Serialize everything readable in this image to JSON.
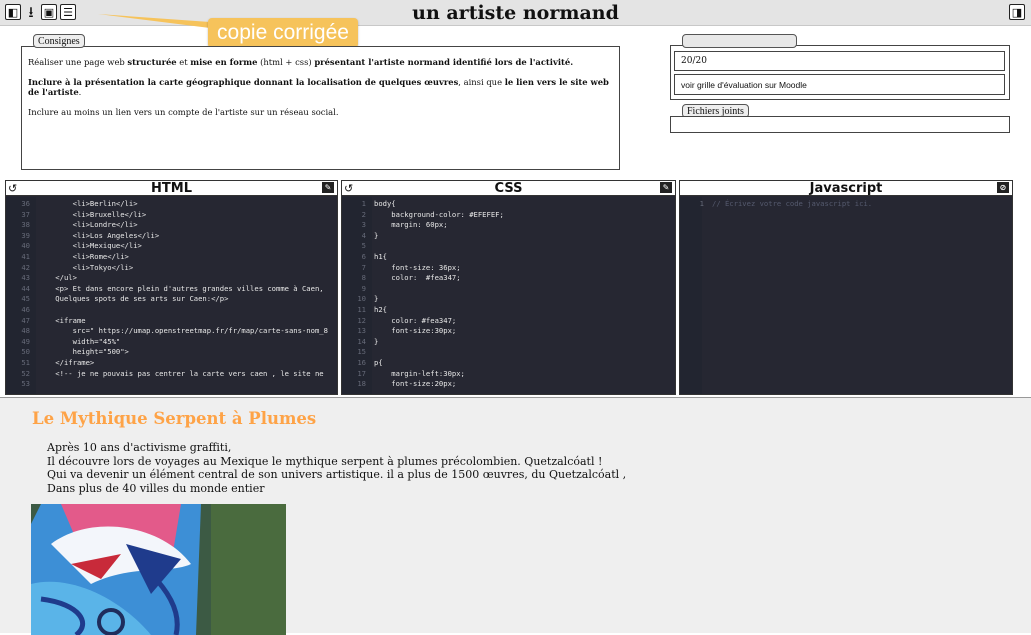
{
  "header": {
    "title": "un artiste normand",
    "tooltip": "copie corrigée",
    "tool_icons": [
      "collapse-left-icon",
      "download-icon",
      "save-icon",
      "list-icon"
    ],
    "right_icon": "collapse-right-icon"
  },
  "consignes": {
    "tab_label": "Consignes",
    "p1_pre": "Réaliser une page web ",
    "p1_b1": "structurée",
    "p1_mid1": "  et ",
    "p1_b2": "mise en forme",
    "p1_mid2": " (html + css) ",
    "p1_b3": "présentant l'artiste normand identifié lors de l'activité.",
    "p2_b1": "Inclure à la présentation la carte géographique donnant la localisation de quelques œuvres",
    "p2_mid": ", ainsi que ",
    "p2_b2": "le lien vers le site web de l'artiste",
    "p2_end": ".",
    "p3": "Inclure au moins un lien vers un compte de l'artiste sur un réseau social."
  },
  "evaluation": {
    "student_tab": "",
    "grade": "20/20",
    "note": "voir grille d'évaluation sur Moodle",
    "files_tab": "Fichiers joints"
  },
  "editors": {
    "html_title": "HTML",
    "css_title": "CSS",
    "js_title": "Javascript",
    "html_lines": [
      {
        "n": "36",
        "t": "        <li>Berlin</li>"
      },
      {
        "n": "37",
        "t": "        <li>Bruxelle</li>"
      },
      {
        "n": "38",
        "t": "        <li>Londre</li>"
      },
      {
        "n": "39",
        "t": "        <li>Los Angeles</li>"
      },
      {
        "n": "40",
        "t": "        <li>Mexique</li>"
      },
      {
        "n": "41",
        "t": "        <li>Rome</li>"
      },
      {
        "n": "42",
        "t": "        <li>Tokyo</li>"
      },
      {
        "n": "43",
        "t": "    </ul>"
      },
      {
        "n": "44",
        "t": "    <p> Et dans encore plein d'autres grandes villes comme à Caen,"
      },
      {
        "n": "45",
        "t": "    Quelques spots de ses arts sur Caen:</p>"
      },
      {
        "n": "46",
        "t": ""
      },
      {
        "n": "47",
        "t": "    <iframe"
      },
      {
        "n": "48",
        "t": "        src=\" https://umap.openstreetmap.fr/fr/map/carte-sans-nom_8"
      },
      {
        "n": "49",
        "t": "        width=\"45%\""
      },
      {
        "n": "50",
        "t": "        height=\"500\">"
      },
      {
        "n": "51",
        "t": "    </iframe>"
      },
      {
        "n": "52",
        "t": "    <!-- je ne pouvais pas centrer la carte vers caen , le site ne"
      },
      {
        "n": "53",
        "t": ""
      }
    ],
    "css_lines": [
      {
        "n": "1",
        "t": "body{"
      },
      {
        "n": "2",
        "t": "    background-color: #EFEFEF;"
      },
      {
        "n": "3",
        "t": "    margin: 60px;"
      },
      {
        "n": "4",
        "t": "}"
      },
      {
        "n": "5",
        "t": ""
      },
      {
        "n": "6",
        "t": "h1{"
      },
      {
        "n": "7",
        "t": "    font-size: 36px;"
      },
      {
        "n": "8",
        "t": "    color:  #fea347;"
      },
      {
        "n": "9",
        "t": ""
      },
      {
        "n": "10",
        "t": "}"
      },
      {
        "n": "11",
        "t": "h2{"
      },
      {
        "n": "12",
        "t": "    color: #fea347;"
      },
      {
        "n": "13",
        "t": "    font-size:30px;"
      },
      {
        "n": "14",
        "t": "}"
      },
      {
        "n": "15",
        "t": ""
      },
      {
        "n": "16",
        "t": "p{"
      },
      {
        "n": "17",
        "t": "    margin-left:30px;"
      },
      {
        "n": "18",
        "t": "    font-size:20px;"
      }
    ],
    "js_lines": [
      {
        "n": "1",
        "t": "// Écrivez votre code javascript ici."
      }
    ]
  },
  "preview": {
    "heading": "Le Mythique Serpent à Plumes",
    "lines": [
      "Après 10 ans d'activisme graffiti,",
      "Il découvre lors de voyages au Mexique le mythique serpent à plumes précolombien. Quetzalcóatl !",
      "Qui va devenir un élément central de son univers artistique. il a plus de 1500 œuvres, du Quetzalcóatl ,",
      "Dans plus de 40 villes du monde entier"
    ]
  },
  "colors": {
    "accent": "#fea347",
    "tooltip": "#f6c35b",
    "editor_bg": "#262732"
  }
}
